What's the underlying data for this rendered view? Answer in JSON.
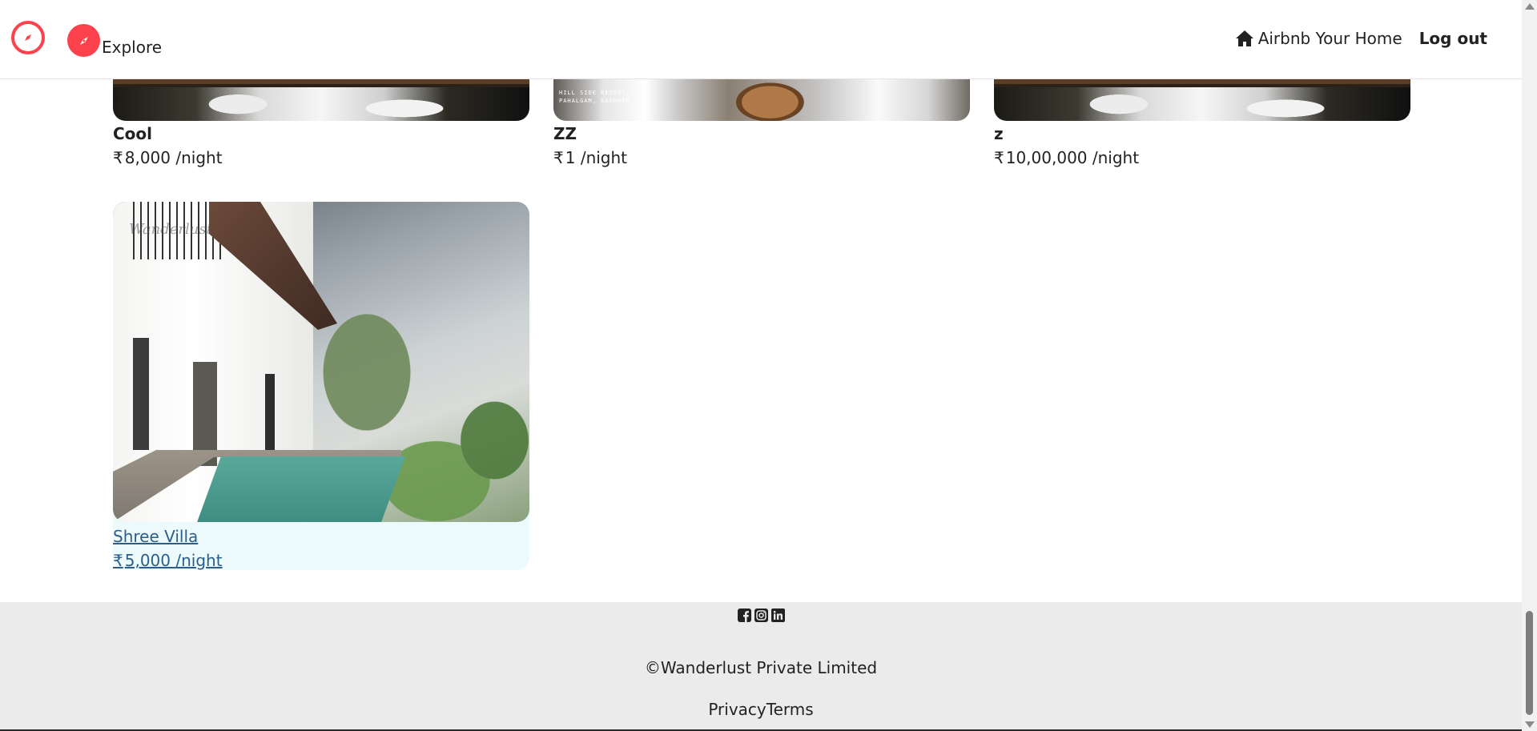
{
  "navbar": {
    "explore_label": "Explore",
    "host_label": "Airbnb Your Home",
    "logout_label": "Log out",
    "accent_color": "#fe424d"
  },
  "listings": [
    {
      "title": "Cool",
      "currency": "₹",
      "price": "8,000",
      "per": "/night",
      "image": "snowy-night-scene"
    },
    {
      "title": "ZZ",
      "currency": "₹",
      "price": "1",
      "per": "/night",
      "image": "white-table-chairs",
      "image_caption": [
        "HILL SIDE RESORT,",
        "PAHALGAM, KASHMIR"
      ]
    },
    {
      "title": "z",
      "currency": "₹",
      "price": "10,00,000",
      "per": "/night",
      "image": "snowy-night-scene"
    },
    {
      "title": "Shree Villa",
      "currency": "₹",
      "price": "5,000",
      "per": "/night",
      "image": "villa-with-pool",
      "image_watermark": "Wanderlust"
    }
  ],
  "footer": {
    "social_icons": [
      "facebook-icon",
      "instagram-icon",
      "linkedin-icon"
    ],
    "copyright": "©Wanderlust Private Limited",
    "privacy_label": "Privacy",
    "terms_label": "Terms"
  }
}
